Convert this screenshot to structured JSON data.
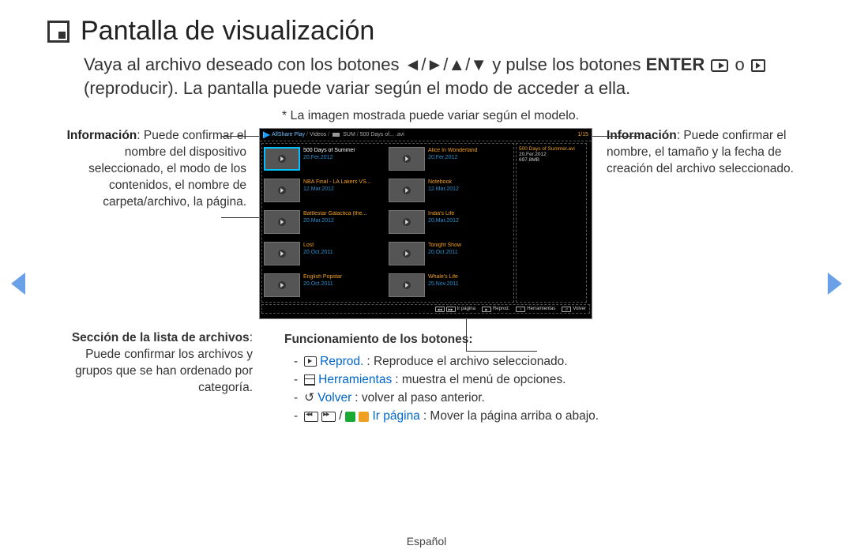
{
  "title": "Pantalla de visualización",
  "intro": {
    "part1": "Vaya al archivo deseado con los botones ",
    "arrows": "◄/►/▲/▼",
    "part2": " y pulse los botones ",
    "enter": "ENTER",
    "part3": " o ",
    "part4": " (reproducir). La pantalla puede variar según el modo de acceder a ella."
  },
  "note": "* La imagen mostrada puede variar según el modelo.",
  "callouts": {
    "info_left": {
      "h": "Información",
      "t": ": Puede confirmar el nombre del dispositivo seleccionado, el modo de los contenidos, el nombre de carpeta/archivo, la página."
    },
    "files": {
      "h": "Sección de la lista de archivos",
      "t": ": Puede confirmar los archivos y grupos que se han ordenado por categoría."
    },
    "info_right": {
      "h": "Información",
      "t": ": Puede confirmar el nombre, el tamaño y la fecha de creación del archivo seleccionado."
    },
    "buttons": {
      "h": "Funcionamiento de los botones:",
      "reprod_w": "Reprod.",
      "reprod_t": ": Reproduce el archivo seleccionado.",
      "herr_w": "Herramientas",
      "herr_t": ": muestra el menú de opciones.",
      "volver_w": "Volver",
      "volver_t": ": volver al paso anterior.",
      "ir_w": "Ir página",
      "ir_t": ": Mover la página arriba o abajo."
    }
  },
  "screen": {
    "breadcrumb": {
      "app": "AllShare Play",
      "s1": "Videos",
      "dev": "SUM",
      "file": "500 Days of... .avi"
    },
    "counter": "1/15",
    "items": [
      [
        {
          "n": "500 Days of Summer",
          "d": "20.Fer.2012",
          "sel": true
        },
        {
          "n": "Alice In Wonderland",
          "d": "20.Fer.2012"
        }
      ],
      [
        {
          "n": "NBA Final - LA Lakers VS...",
          "d": "12.Mar.2012"
        },
        {
          "n": "Notebook",
          "d": "12.Mar.2012"
        }
      ],
      [
        {
          "n": "Battlestar Galactica (the...",
          "d": "20.Mar.2012"
        },
        {
          "n": "India's Life",
          "d": "20.Mar.2012"
        }
      ],
      [
        {
          "n": "Lost",
          "d": "20.Oct.2011"
        },
        {
          "n": "Tonight Show",
          "d": "20.Oct.2011"
        }
      ],
      [
        {
          "n": "English Popstar",
          "d": "20.Oct.2011"
        },
        {
          "n": "Whale's Life",
          "d": "25.Nov.2011"
        }
      ]
    ],
    "info": {
      "fn": "500 Days of Summer.avi",
      "date": "20.Fer.2012",
      "size": "697.8MB"
    },
    "footer": {
      "page": "Ir página",
      "play": "Reprod.",
      "tools": "Herramientas",
      "back": "Volver"
    }
  },
  "footer": "Español"
}
